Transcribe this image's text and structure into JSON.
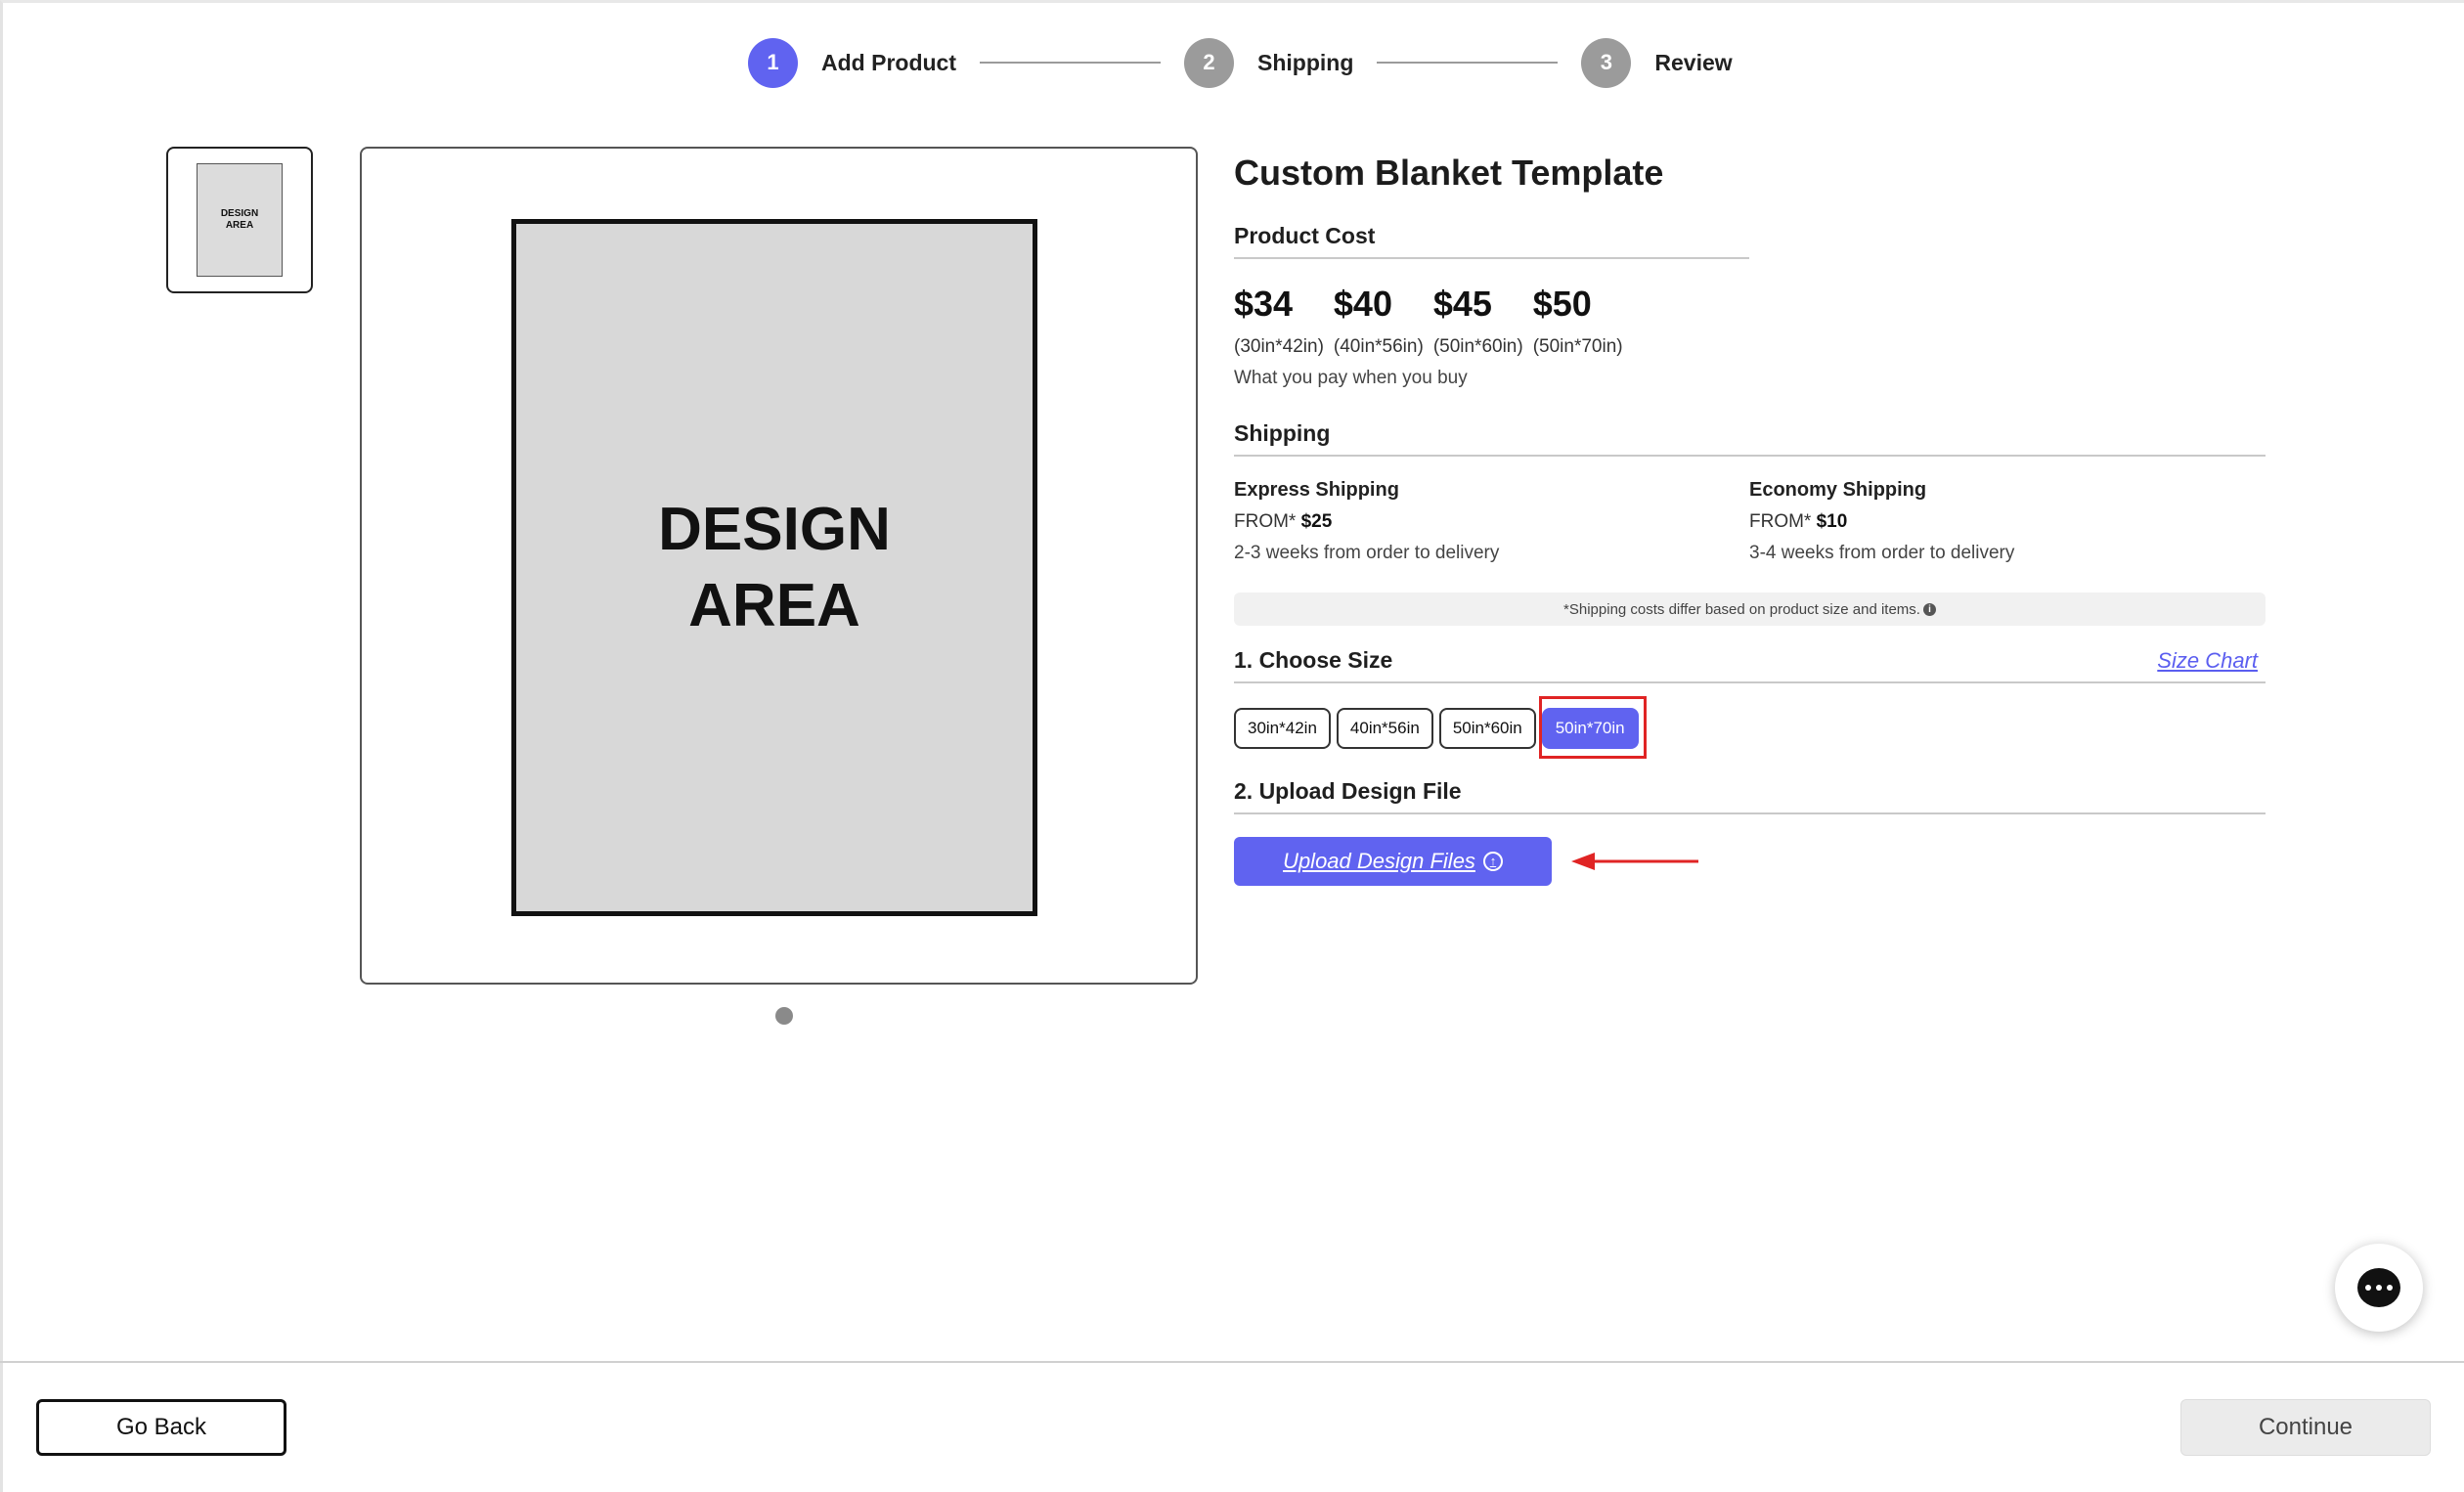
{
  "stepper": {
    "steps": [
      {
        "number": "1",
        "label": "Add Product",
        "state": "active"
      },
      {
        "number": "2",
        "label": "Shipping",
        "state": "inactive"
      },
      {
        "number": "3",
        "label": "Review",
        "state": "inactive"
      }
    ]
  },
  "preview": {
    "thumbnail_text": "DESIGN\nAREA",
    "design_area_text": "DESIGN\nAREA"
  },
  "product": {
    "title": "Custom Blanket Template",
    "cost_heading": "Product Cost",
    "prices": [
      {
        "value": "$34",
        "size": "(30in*42in)"
      },
      {
        "value": "$40",
        "size": "(40in*56in)"
      },
      {
        "value": "$45",
        "size": "(50in*60in)"
      },
      {
        "value": "$50",
        "size": "(50in*70in)"
      }
    ],
    "pay_note": "What you pay when you buy"
  },
  "shipping": {
    "heading": "Shipping",
    "options": [
      {
        "name": "Express Shipping",
        "from_label": "FROM*",
        "price": "$25",
        "eta": "2-3 weeks from order to delivery"
      },
      {
        "name": "Economy Shipping",
        "from_label": "FROM*",
        "price": "$10",
        "eta": "3-4 weeks from order to delivery"
      }
    ],
    "note": "*Shipping costs differ based on product size and items."
  },
  "size": {
    "heading": "1. Choose Size",
    "chart_link": "Size Chart",
    "options": [
      "30in*42in",
      "40in*56in",
      "50in*60in",
      "50in*70in"
    ],
    "selected": "50in*70in"
  },
  "upload": {
    "heading": "2. Upload Design File",
    "button_label": "Upload Design Files"
  },
  "footer": {
    "back_label": "Go Back",
    "continue_label": "Continue"
  },
  "colors": {
    "accent": "#6063f0",
    "highlight": "#e02424",
    "inactive_step": "#9b9b9b"
  },
  "icons": {
    "upload": "upload-arrow-circle-icon",
    "info": "info-icon",
    "chat": "chat-bubble-icon"
  }
}
